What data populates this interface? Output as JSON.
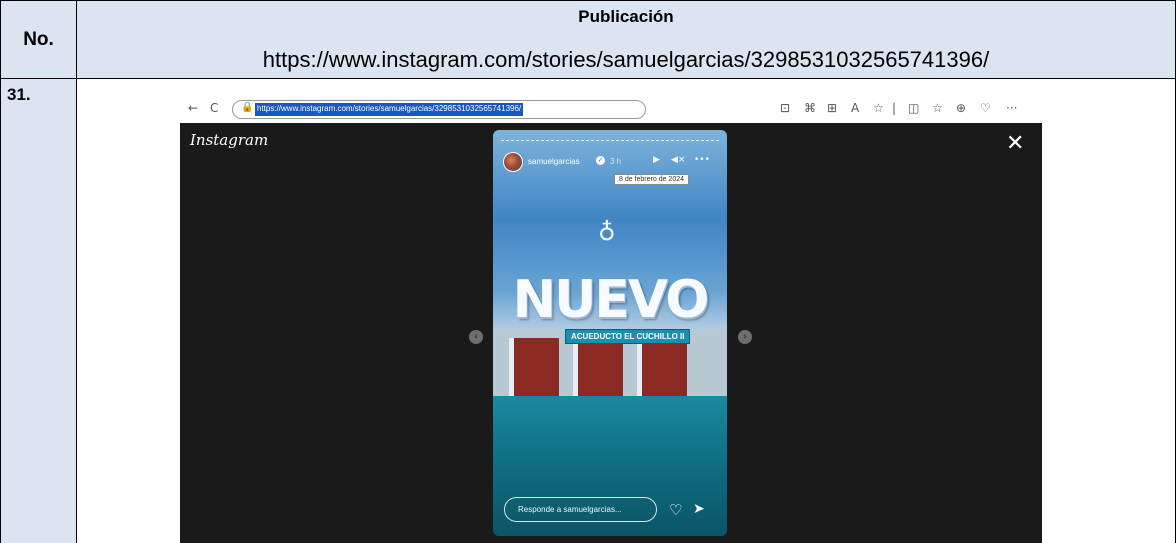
{
  "header": {
    "no_label": "No.",
    "publicacion_label": "Publicación",
    "url": "https://www.instagram.com/stories/samuelgarcias/3298531032565741396/"
  },
  "row": {
    "number": "31."
  },
  "browser": {
    "back_icon": "←",
    "reload_icon": "C",
    "lock_icon": "🔒",
    "address": "https://www.instagram.com/stories/samuelgarcias/3298531032565741396/",
    "toolbar_icons": [
      "⊡",
      "⌘",
      "⊞",
      "A",
      "☆",
      "|",
      "◫",
      "☆",
      "⊕",
      "♡",
      "···"
    ]
  },
  "instagram": {
    "logo": "Instagram",
    "close_icon": "✕",
    "prev_icon": "‹",
    "next_icon": "›",
    "story": {
      "username": "samuelgarcias",
      "verified_icon": "✓",
      "time": "3 h",
      "play_icon": "▶",
      "mute_icon": "◀×",
      "more_icon": "•••",
      "tooltip": "8 de febrero de 2024",
      "emblem": "♁",
      "headline": "NUEVO",
      "subheadline": "ACUEDUCTO EL CUCHILLO II",
      "reply_placeholder": "Responde a samuelgarcias...",
      "heart_icon": "♡",
      "send_icon": "➤"
    }
  }
}
